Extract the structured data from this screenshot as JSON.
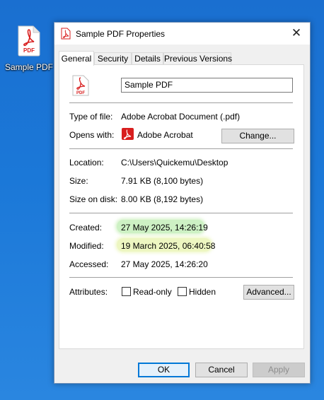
{
  "desktop": {
    "icon_label": "Sample PDF"
  },
  "window": {
    "title": "Sample PDF Properties",
    "tabs": [
      "General",
      "Security",
      "Details",
      "Previous Versions"
    ],
    "active_tab": "General",
    "name_value": "Sample PDF",
    "fields": {
      "type_label": "Type of file:",
      "type_value": "Adobe Acrobat Document (.pdf)",
      "opens_label": "Opens with:",
      "opens_value": "Adobe Acrobat",
      "change_button": "Change...",
      "location_label": "Location:",
      "location_value": "C:\\Users\\Quickemu\\Desktop",
      "size_label": "Size:",
      "size_value": "7.91 KB (8,100 bytes)",
      "disk_label": "Size on disk:",
      "disk_value": "8.00 KB (8,192 bytes)",
      "created_label": "Created:",
      "created_value": "27 May 2025, 14:26:19",
      "modified_label": "Modified:",
      "modified_value": "19 March 2025, 06:40:58",
      "accessed_label": "Accessed:",
      "accessed_value": "27 May 2025, 14:26:20",
      "attributes_label": "Attributes:",
      "readonly_label": "Read-only",
      "hidden_label": "Hidden",
      "advanced_button": "Advanced..."
    },
    "buttons": {
      "ok": "OK",
      "cancel": "Cancel",
      "apply": "Apply"
    },
    "colors": {
      "pdf_red": "#d81e1e",
      "highlight_green": "#c8f0be",
      "highlight_yellow": "#ecf6be"
    },
    "icons": {
      "file_icon": "pdf-file-icon",
      "app_icon": "acrobat-icon",
      "close": "close-icon"
    },
    "pdf_badge": "PDF"
  }
}
